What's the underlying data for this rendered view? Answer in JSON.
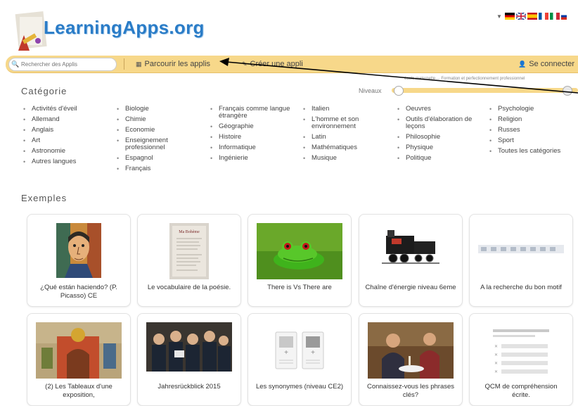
{
  "header": {
    "logo_text": "LearningApps.org",
    "flags": [
      "de",
      "en",
      "es",
      "fr",
      "it",
      "ru"
    ]
  },
  "nav": {
    "search_placeholder": "Rechercher des Applis",
    "browse": "Parcourir les applis",
    "create": "Créer une appli",
    "login": "Se connecter"
  },
  "filter": {
    "level_top": "école maternelle ... Formation et perfectionnement professionnel",
    "category_title": "Catégorie",
    "levels_label": "Niveaux"
  },
  "categories": {
    "col1": [
      "Activités d'éveil",
      "Allemand",
      "Anglais",
      "Art",
      "Astronomie",
      "Autres langues"
    ],
    "col2": [
      "Biologie",
      "Chimie",
      "Economie",
      "Enseignement professionnel",
      "Espagnol",
      "Français"
    ],
    "col3": [
      "Français comme langue étrangère",
      "Géographie",
      "Histoire",
      "Informatique",
      "Ingénierie"
    ],
    "col4": [
      "Italien",
      "L'homme et son environnement",
      "Latin",
      "Mathématiques",
      "Musique"
    ],
    "col5": [
      "Oeuvres",
      "Outils d'élaboration de leçons",
      "Philosophie",
      "Physique",
      "Politique"
    ],
    "col6": [
      "Psychologie",
      "Religion",
      "Russes",
      "Sport",
      "Toutes les catégories"
    ]
  },
  "examples": {
    "title": "Exemples",
    "cards": [
      {
        "caption": "¿Qué están haciendo? (P. Picasso) CE"
      },
      {
        "caption": "Le vocabulaire de la poésie."
      },
      {
        "caption": "There is Vs There are"
      },
      {
        "caption": "Chaîne d'énergie niveau 6eme"
      },
      {
        "caption": "A la recherche du bon motif"
      },
      {
        "caption": "(2) Les Tableaux d'une exposition,"
      },
      {
        "caption": "Jahresrückblick 2015"
      },
      {
        "caption": "Les synonymes (niveau CE2)"
      },
      {
        "caption": "Connaissez-vous les phrases clés?"
      },
      {
        "caption": "QCM de compréhension écrite."
      }
    ]
  },
  "colors": {
    "brand_blue": "#2a7cc7",
    "nav_bar": "#f7d88a"
  }
}
